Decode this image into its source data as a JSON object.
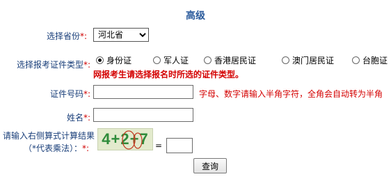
{
  "header": {
    "title": "高级"
  },
  "province": {
    "label": "选择省份",
    "required_mark": "*:",
    "selected": "河北省"
  },
  "cert_type": {
    "label": "选择报考证件类型",
    "required_mark": "*:",
    "options": [
      "身份证",
      "军人证",
      "香港居民证",
      "澳门居民证",
      "台胞证"
    ],
    "selected_index": 0,
    "warning": "网报考生请选择报名时所选的证件类型。"
  },
  "cert_number": {
    "label": "证件号码",
    "required_mark": "*:",
    "value": "",
    "hint": "字母、数字请输入半角字符，全角会自动转为半角"
  },
  "name_field": {
    "label": "姓名",
    "required_mark": "*:",
    "value": ""
  },
  "captcha": {
    "label_line1": "请输入右侧算式计算结果",
    "label_line2": "（*代表乘法）：",
    "required_mark": "*:",
    "image_text": "4+2+7",
    "equals": "=",
    "answer": ""
  },
  "submit": {
    "label": "查询"
  },
  "colors": {
    "title": "#2b5b9c",
    "label": "#1a3f7a",
    "required": "#d00000",
    "warning": "#d40000",
    "captcha_bg": "#e3eacd",
    "captcha_fg": "#2e8b3a"
  }
}
